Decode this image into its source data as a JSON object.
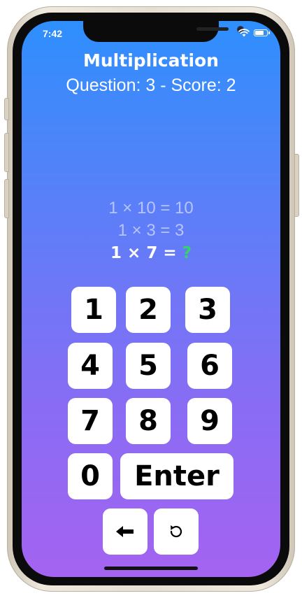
{
  "status_bar": {
    "time": "7:42",
    "icons": [
      "wifi-icon",
      "battery-icon"
    ]
  },
  "header": {
    "title": "Multiplication",
    "subtitle": "Question: 3 - Score: 2"
  },
  "history": [
    "1 × 10 = 10",
    "1 × 3 = 3"
  ],
  "current_question": {
    "prompt": "1 × 7 =",
    "answer_placeholder": "?"
  },
  "keypad": {
    "digits": [
      "1",
      "2",
      "3",
      "4",
      "5",
      "6",
      "7",
      "8",
      "9",
      "0"
    ],
    "enter_label": "Enter",
    "backspace_glyph": "🠔",
    "reset_glyph": "↺"
  },
  "colors": {
    "gradient_top": "#2e8ffd",
    "gradient_bottom": "#a463f1",
    "answer_mark": "#36d36a"
  }
}
